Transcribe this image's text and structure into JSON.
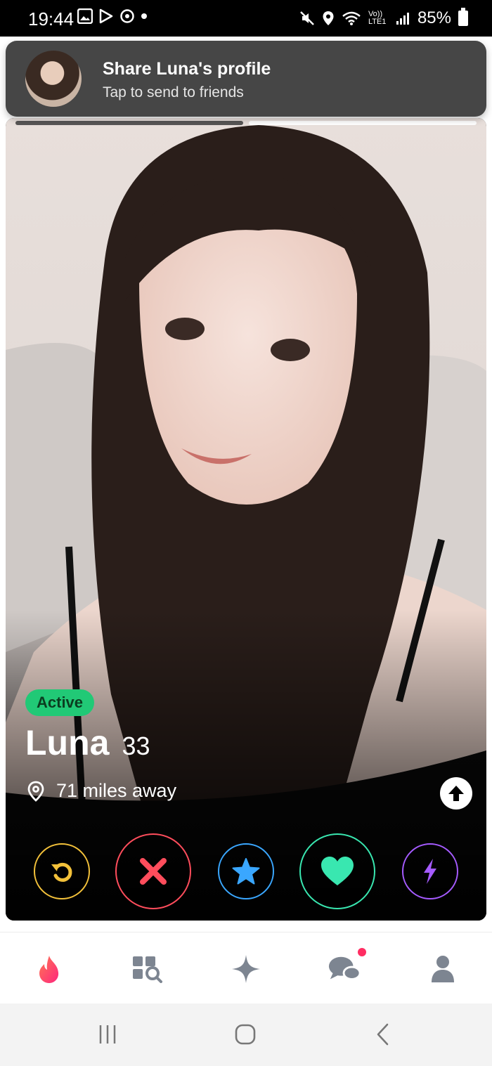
{
  "status_bar": {
    "time": "19:44",
    "network_label": "Vo)) LTE1",
    "battery_percent": "85%"
  },
  "toast": {
    "title": "Share Luna's profile",
    "subtitle": "Tap to send to friends"
  },
  "profile": {
    "active_badge": "Active",
    "name": "Luna",
    "age": "33",
    "distance": "71 miles away",
    "photo_index_active": 2,
    "photo_count": 2
  },
  "actions": {
    "icons": [
      "rewind-icon",
      "close-icon",
      "star-icon",
      "heart-icon",
      "lightning-icon"
    ],
    "colors": {
      "rewind": "#f3c13a",
      "nope": "#ff4d5c",
      "super_like": "#3aa7ff",
      "like": "#39e7b0",
      "boost": "#a55bff"
    }
  },
  "bottom_nav": {
    "icons": [
      "flame-icon",
      "explore-icon",
      "sparkle-icon",
      "chat-icon",
      "profile-icon"
    ],
    "chat_has_notification": true,
    "brand_color": "#ff4458"
  },
  "system_nav": {
    "icons": [
      "recents-icon",
      "home-icon",
      "back-icon"
    ]
  }
}
